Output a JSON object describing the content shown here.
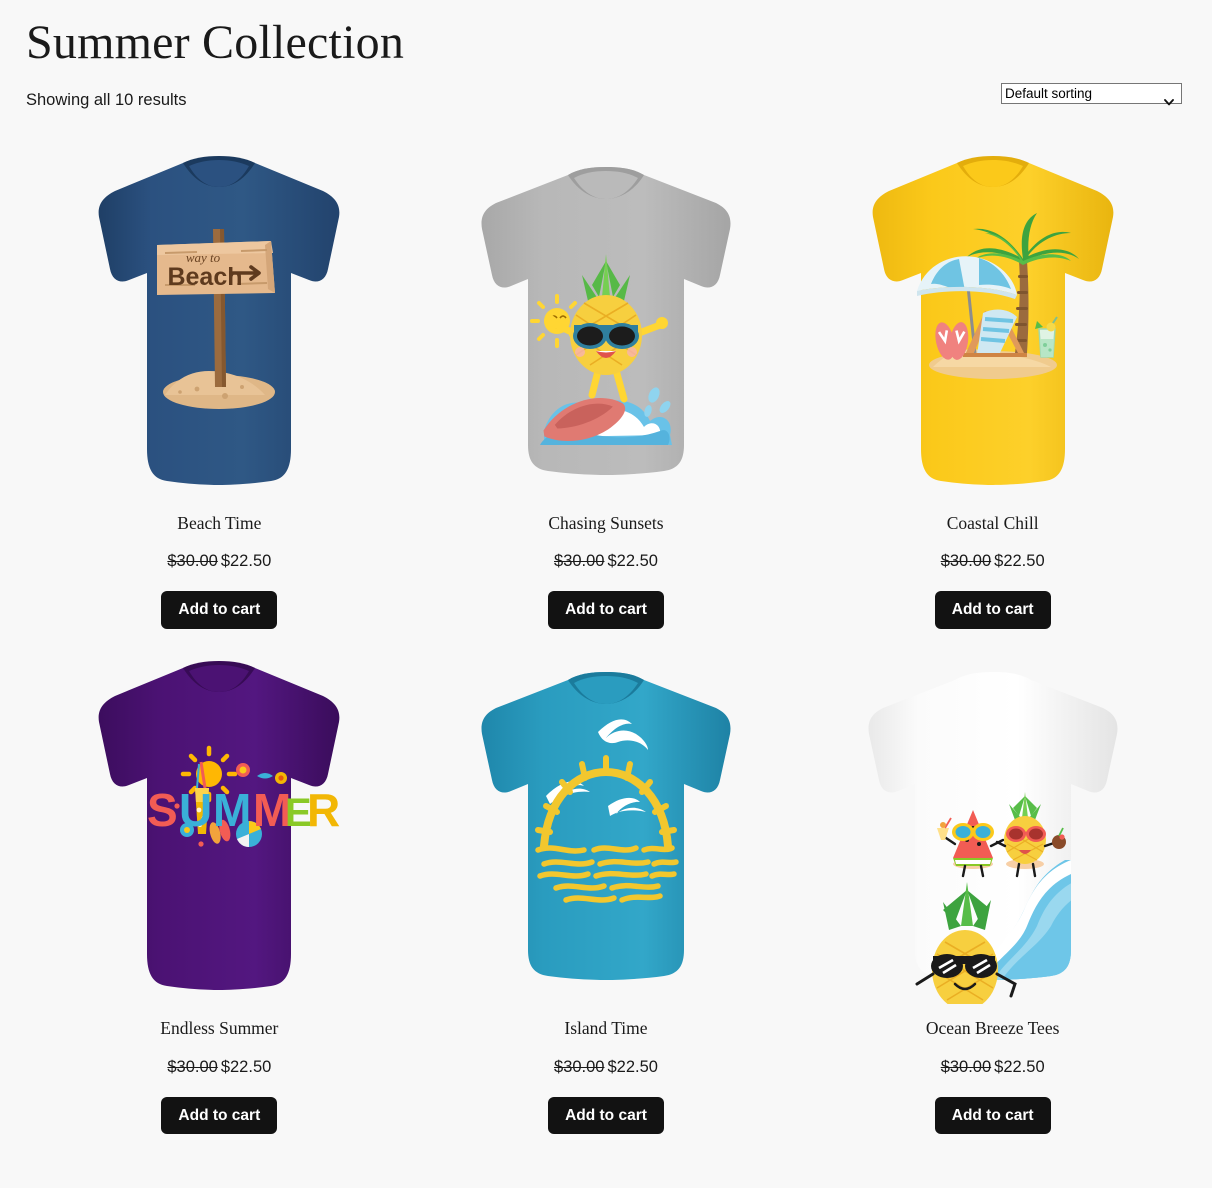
{
  "header": {
    "title": "Summer Collection",
    "result_count": "Showing all 10 results",
    "sort": {
      "selected": "Default sorting",
      "options": [
        "Default sorting"
      ],
      "icon": "chevron-down-icon"
    }
  },
  "labels": {
    "add_to_cart": "Add to cart"
  },
  "colors": {
    "page_background": "#f8f8f8",
    "text": "#1a1a1a",
    "button_background": "#121212",
    "button_text": "#ffffff"
  },
  "products": [
    {
      "name": "Beach Time",
      "old_price": "$30.00",
      "new_price": "$22.50",
      "add_to_cart": "Add to cart",
      "shirt_color": "#2b5180",
      "artwork": "beach-sign-in-sand"
    },
    {
      "name": "Chasing Sunsets",
      "old_price": "$30.00",
      "new_price": "$22.50",
      "add_to_cart": "Add to cart",
      "shirt_color": "#b4b4b4",
      "artwork": "surfing-pineapple-with-sun"
    },
    {
      "name": "Coastal Chill",
      "old_price": "$30.00",
      "new_price": "$22.50",
      "add_to_cart": "Add to cart",
      "shirt_color": "#fbc91a",
      "artwork": "palm-umbrella-deckchair-beach-scene"
    },
    {
      "name": "Endless Summer",
      "old_price": "$30.00",
      "new_price": "$22.50",
      "add_to_cart": "Add to cart",
      "shirt_color": "#4b1273",
      "artwork": "colorful-summer-lettering"
    },
    {
      "name": "Island Time",
      "old_price": "$30.00",
      "new_price": "$22.50",
      "add_to_cart": "Add to cart",
      "shirt_color": "#2a9cbf",
      "artwork": "sun-over-water-with-seagulls"
    },
    {
      "name": "Ocean Breeze Tees",
      "old_price": "$30.00",
      "new_price": "$22.50",
      "add_to_cart": "Add to cart",
      "shirt_color": "#ffffff",
      "artwork": "fruit-characters-with-wave"
    }
  ]
}
